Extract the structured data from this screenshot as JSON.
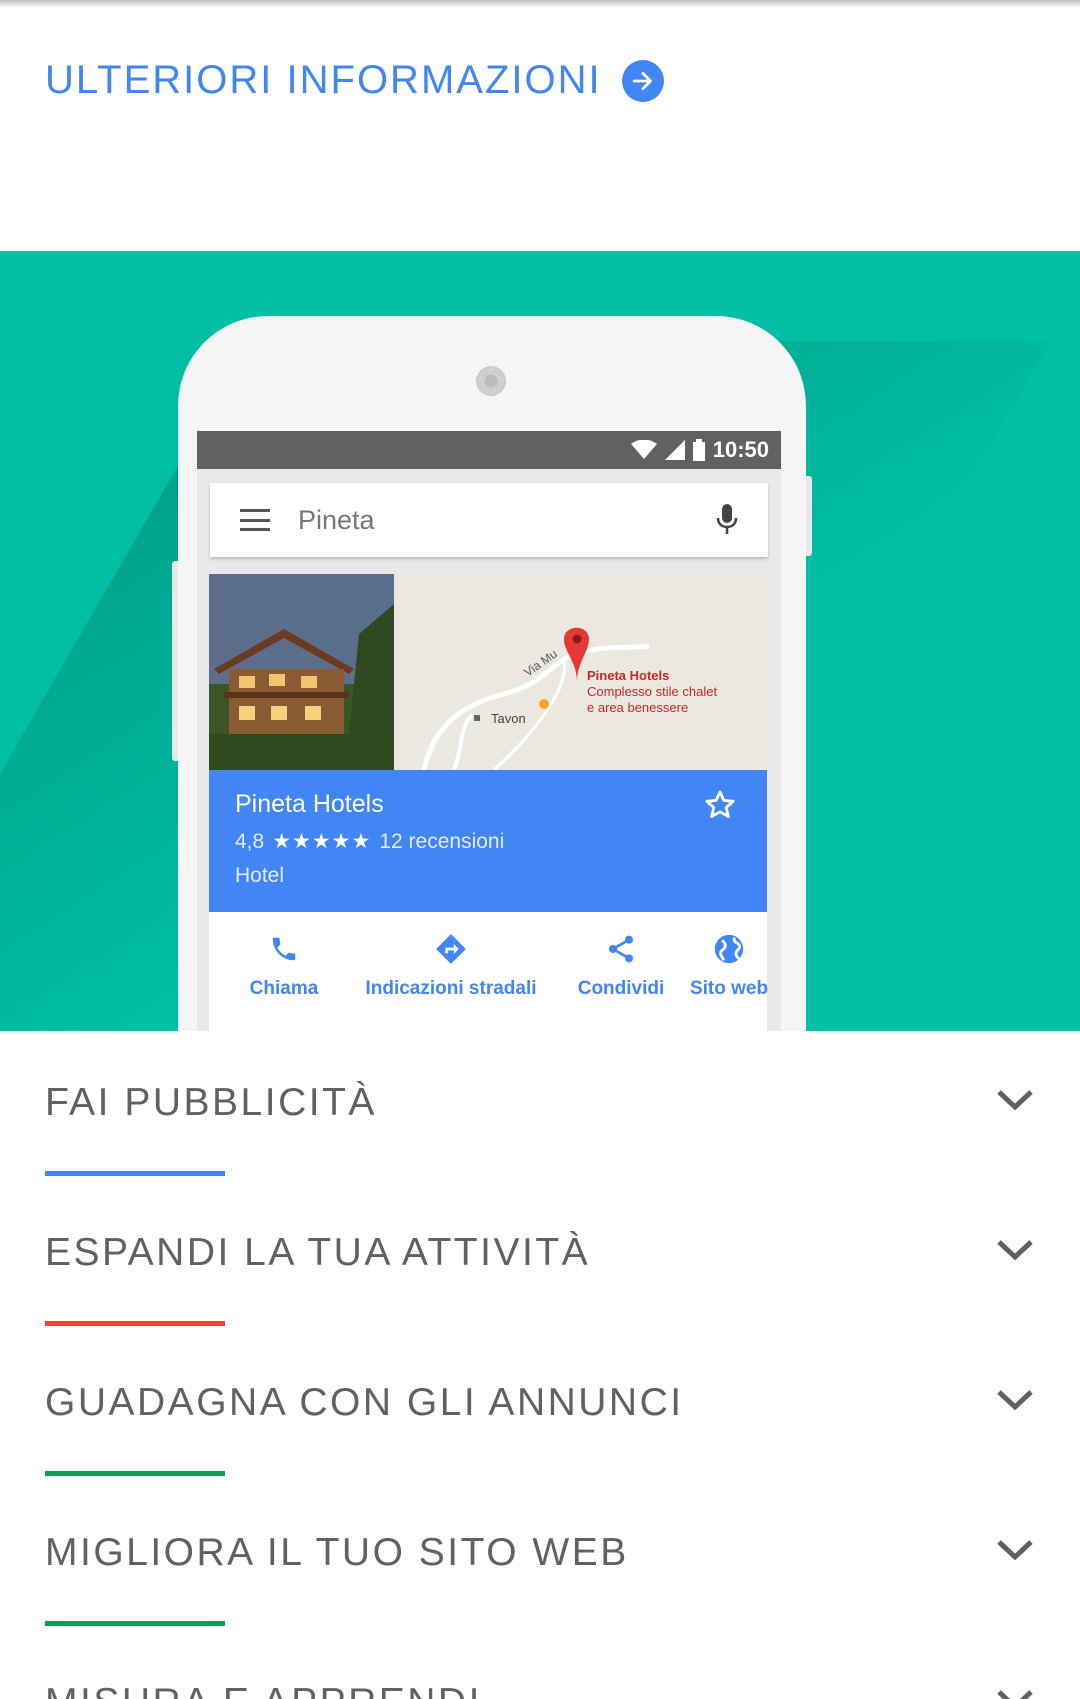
{
  "learn_more": {
    "label": "ULTERIORI INFORMAZIONI",
    "icon": "arrow-right-circle-icon"
  },
  "phone": {
    "status_time": "10:50",
    "search": {
      "placeholder": "Pineta"
    },
    "map": {
      "road_label": "Via Mu",
      "town_label": "Tavon",
      "pin_title": "Pineta Hotels",
      "pin_line1": "Complesso stile chalet",
      "pin_line2": "e area benessere"
    },
    "place": {
      "name": "Pineta Hotels",
      "rating": "4,8",
      "stars": "★★★★★",
      "reviews": "12 recensioni",
      "type": "Hotel"
    },
    "actions": [
      {
        "label": "Chiama",
        "icon": "phone-icon"
      },
      {
        "label": "Indicazioni stradali",
        "icon": "directions-icon"
      },
      {
        "label": "Condividi",
        "icon": "share-icon"
      },
      {
        "label": "Sito web",
        "icon": "globe-icon"
      }
    ]
  },
  "accordion": [
    {
      "title": "FAI PUBBLICITÀ",
      "color": "#4285f4"
    },
    {
      "title": "ESPANDI LA TUA ATTIVITÀ",
      "color": "#ea4335"
    },
    {
      "title": "GUADAGNA CON GLI ANNUNCI",
      "color": "#0f9d58"
    },
    {
      "title": "MIGLIORA IL TUO SITO WEB",
      "color": "#0f9d58"
    },
    {
      "title": "MISURA E APPRENDI",
      "color": "#4285f4"
    }
  ]
}
